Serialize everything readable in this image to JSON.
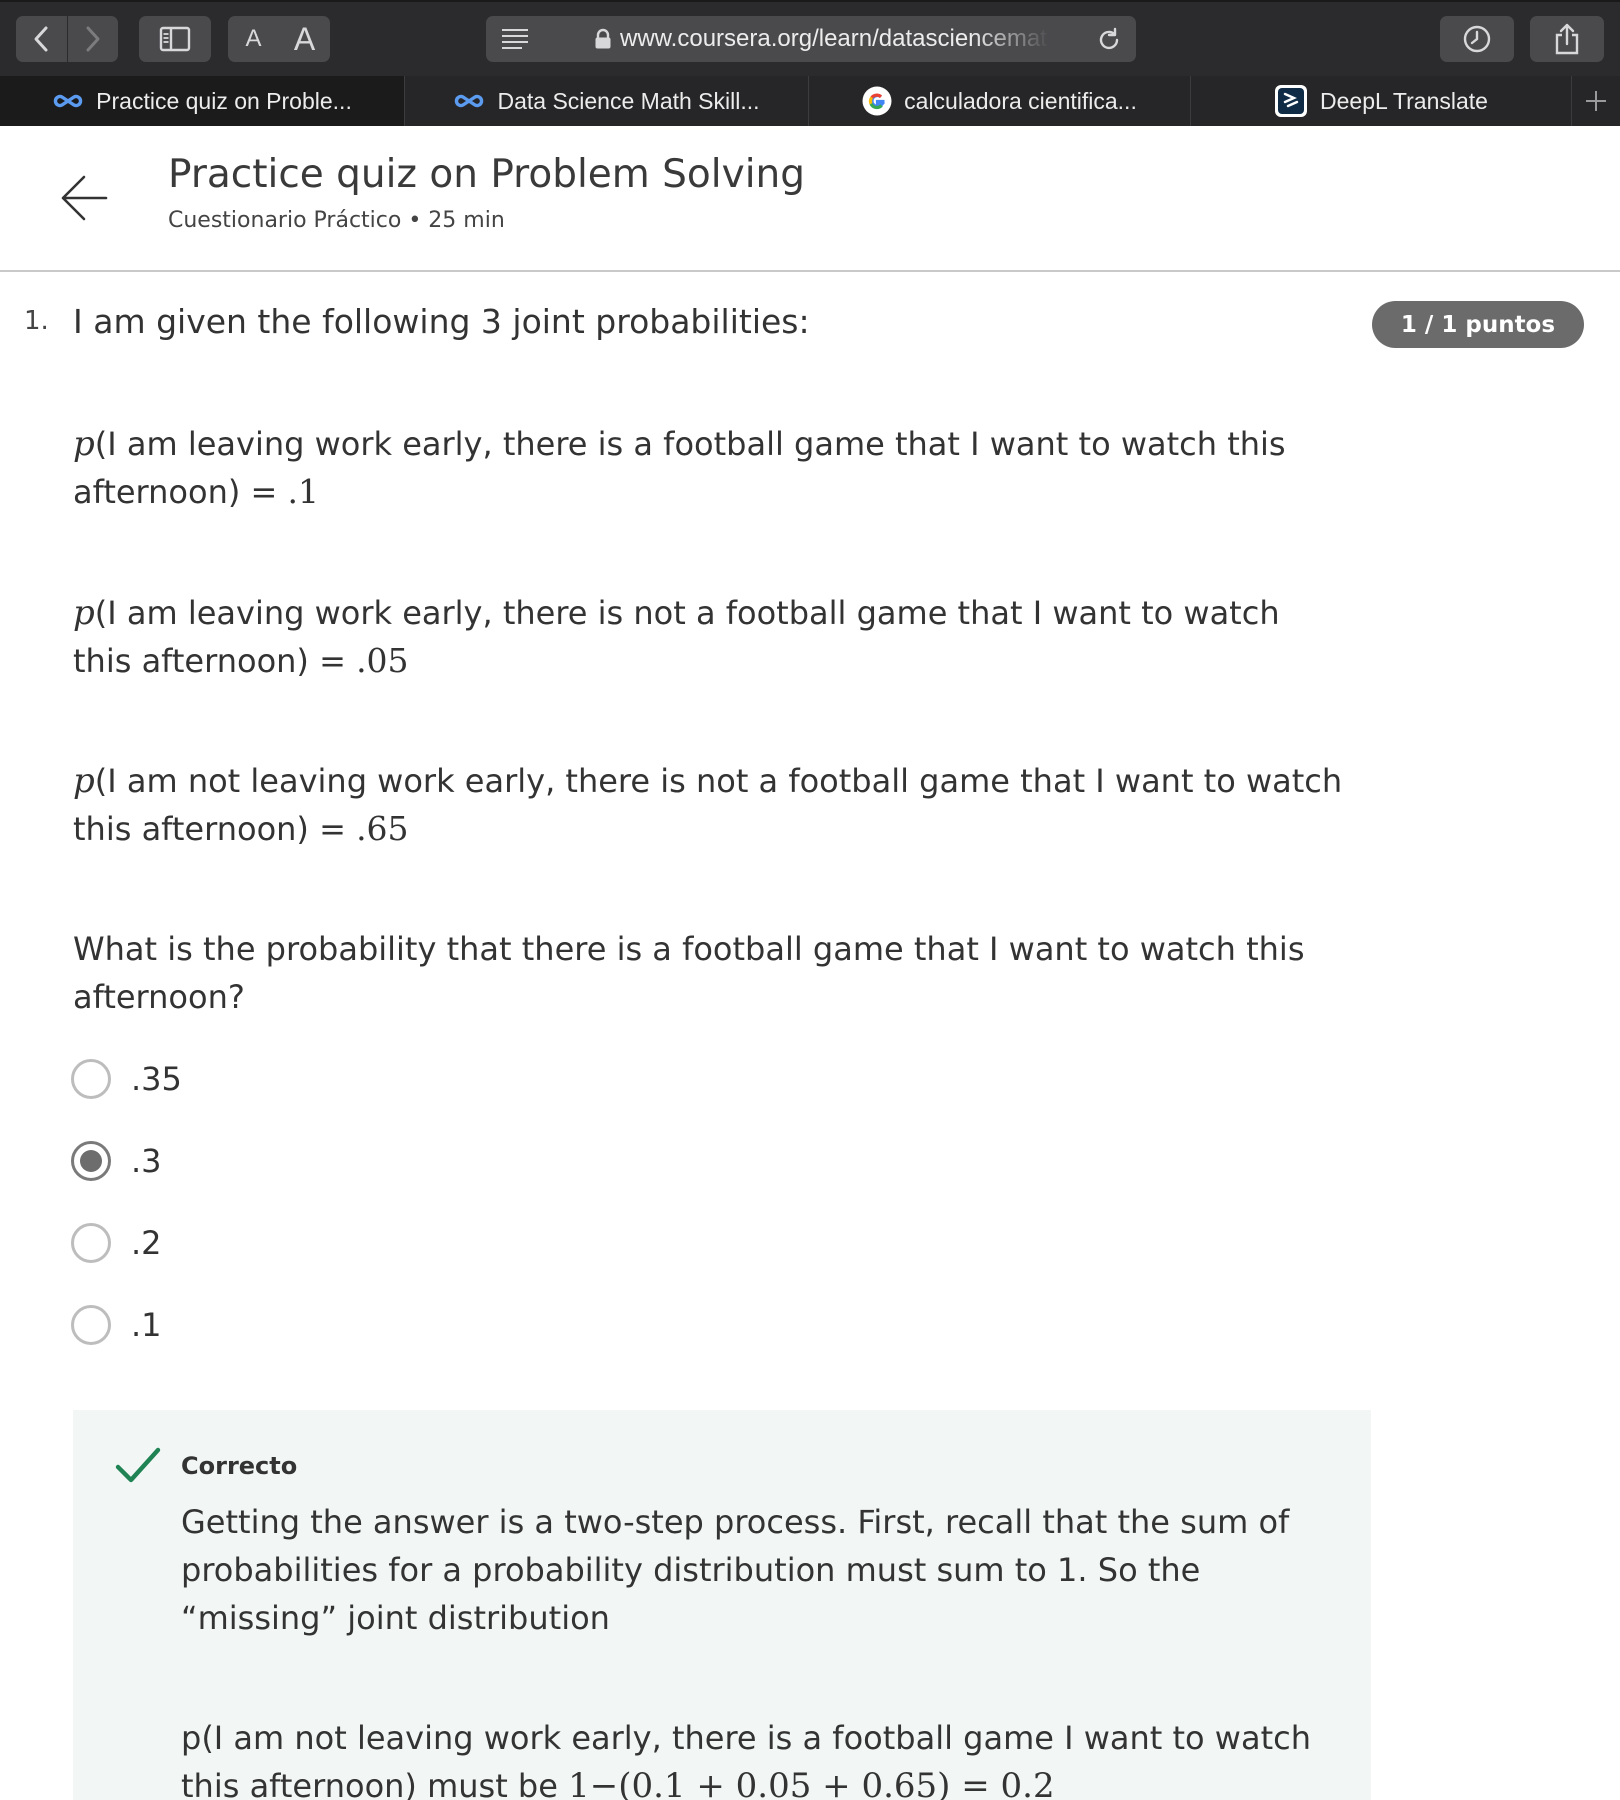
{
  "browser": {
    "url": "www.coursera.org/learn/datasciencemathskills",
    "tabs": [
      {
        "label": "Practice quiz on Proble...",
        "icon": "coursera-icon",
        "active": true
      },
      {
        "label": "Data Science Math Skill...",
        "icon": "coursera-icon",
        "active": false
      },
      {
        "label": "calculadora cientifica...",
        "icon": "google-icon",
        "active": false
      },
      {
        "label": "DeepL Translate",
        "icon": "deepl-icon",
        "active": false
      }
    ],
    "text_size_small": "A",
    "text_size_large": "A"
  },
  "header": {
    "title": "Practice quiz on Problem Solving",
    "subtitle": "Cuestionario Práctico • 25 min"
  },
  "question": {
    "number": "1.",
    "prompt": "I am given the following 3 joint probabilities:",
    "score": "1 / 1 puntos",
    "probabilities": [
      {
        "symbol": "p",
        "text": "(I am leaving work early, there is a football game that I want to watch this afternoon) = ",
        "value": ".1"
      },
      {
        "symbol": "p",
        "text": "(I am leaving work early, there is not a football game that I want to watch this afternoon) = ",
        "value": ".05"
      },
      {
        "symbol": "p",
        "text": "(I am not leaving work early, there is not a football game that I want to watch this afternoon) = ",
        "value": ".65"
      }
    ],
    "ask": "What is the probability that there is a football game that I want to watch this afternoon?",
    "options": [
      {
        "label": ".35",
        "selected": false
      },
      {
        "label": ".3",
        "selected": true
      },
      {
        "label": ".2",
        "selected": false
      },
      {
        "label": ".1",
        "selected": false
      }
    ]
  },
  "feedback": {
    "status": "Correcto",
    "explanation": "Getting the answer is a two-step process. First, recall that the sum of probabilities for a probability distribution must sum to 1. So the “missing” joint distribution",
    "detail_text": "p(I am not leaving work early, there is a football game I want to watch this afternoon) must be ",
    "detail_math": "1−(0.1 + 0.05 + 0.65) = 0.2"
  },
  "colors": {
    "toolbar_bg": "#2b2b2d",
    "badge_bg": "#6b6b6b",
    "correct_green": "#1f8354",
    "feedback_bg": "#f2f7f6"
  }
}
